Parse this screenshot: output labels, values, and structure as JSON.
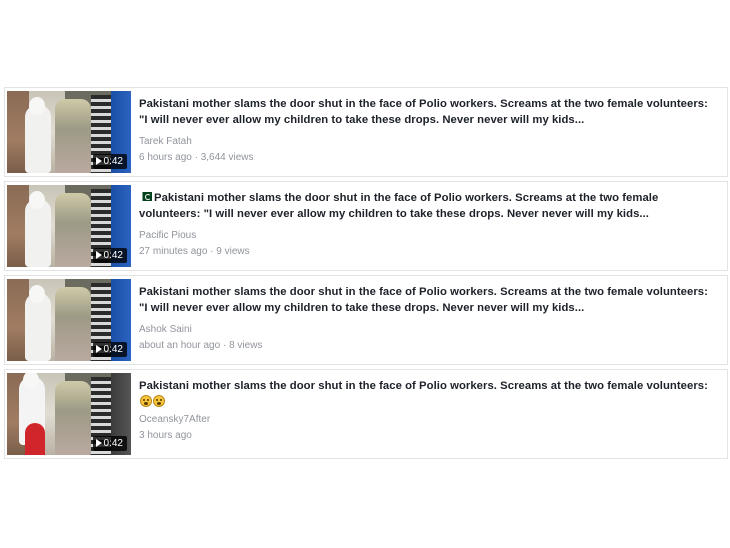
{
  "results": [
    {
      "title": "Pakistani mother slams the door shut in the face of Polio workers. Screams at the two female volunteers: \"I will never ever allow my children to take these drops. Never never will my kids...",
      "author": "Tarek Fatah",
      "meta": "6 hours ago · 3,644 views",
      "duration": "0:42",
      "has_flag": false
    },
    {
      "title": "Pakistani mother slams the door shut in the face of Polio workers. Screams at the two female volunteers: \"I will never ever allow my children to take these drops. Never never will my kids...",
      "author": "Pacific Pious",
      "meta": "27 minutes ago · 9 views",
      "duration": "0:42",
      "has_flag": true
    },
    {
      "title": "Pakistani mother slams the door shut in the face of Polio workers. Screams at the two female volunteers: \"I will never ever allow my children to take these drops. Never never will my kids...",
      "author": "Ashok Saini",
      "meta": "about an hour ago · 8 views",
      "duration": "0:42",
      "has_flag": false
    },
    {
      "title": "Pakistani mother slams the door shut in the face of Polio workers. Screams at the two female volunteers:",
      "author": "Oceansky7After",
      "meta": "3 hours ago",
      "duration": "0:42",
      "has_flag": false,
      "emojis": [
        "astonished-face-icon",
        "worried-face-icon"
      ]
    }
  ]
}
